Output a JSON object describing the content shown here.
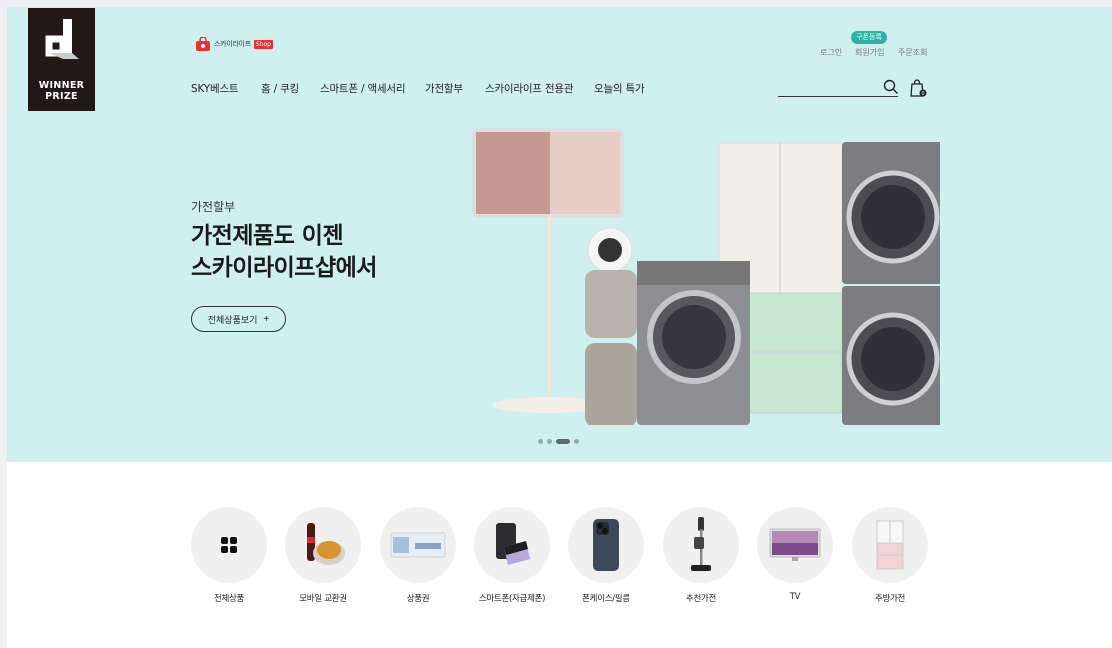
{
  "badge": {
    "line1": "WINNER",
    "line2": "PRIZE"
  },
  "header": {
    "logo_text": "스카이라이프",
    "logo_shop": "Shop",
    "coupon": "구폰등록",
    "util_links": [
      "로그인",
      "회원가입",
      "주문조회"
    ],
    "cart_count": "0"
  },
  "nav": [
    "SKY베스트",
    "홈 / 쿠킹",
    "스마트폰 / 액세서리",
    "가전할부",
    "스카이라이프 전용관",
    "오늘의 특가"
  ],
  "search": {
    "placeholder": ""
  },
  "hero": {
    "category": "가전할부",
    "title_line1": "가전제품도 이젠",
    "title_line2": "스카이라이프샵에서",
    "button_label": "전체상품보기",
    "button_icon": "+",
    "slides_total": 4,
    "slide_active": 3
  },
  "categories": [
    {
      "label": "전체상품",
      "icon": "grid-icon"
    },
    {
      "label": "모바일 교환권",
      "icon": "chicken-cola-icon"
    },
    {
      "label": "상품권",
      "icon": "gift-voucher-icon"
    },
    {
      "label": "스마트폰(자급제폰)",
      "icon": "foldable-phone-icon"
    },
    {
      "label": "폰케이스/필름",
      "icon": "phone-case-icon"
    },
    {
      "label": "추천가전",
      "icon": "stick-vacuum-icon"
    },
    {
      "label": "TV",
      "icon": "tv-icon"
    },
    {
      "label": "주방가전",
      "icon": "fridge-icon"
    }
  ],
  "colors": {
    "hero_bg": "#cff0ee",
    "coupon": "#2ab3a6",
    "shop_red": "#e8322e",
    "badge": "#231815"
  }
}
